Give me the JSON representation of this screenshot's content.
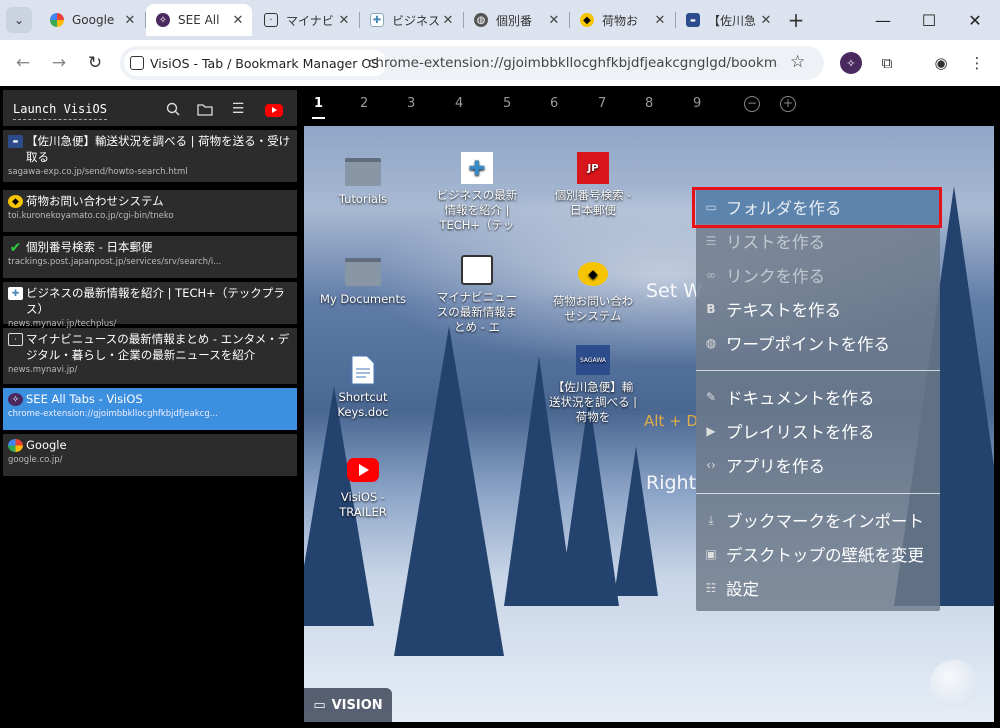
{
  "browser": {
    "tabs": [
      {
        "title": "Google",
        "icon": "google-icon",
        "active": false
      },
      {
        "title": "SEE All",
        "icon": "visios-icon",
        "active": true
      },
      {
        "title": "マイナビ",
        "icon": "monitor-icon",
        "active": false
      },
      {
        "title": "ビジネス",
        "icon": "techplus-icon",
        "active": false
      },
      {
        "title": "個別番",
        "icon": "globe-icon",
        "active": false
      },
      {
        "title": "荷物お",
        "icon": "yamato-icon",
        "active": false
      },
      {
        "title": "【佐川急",
        "icon": "sagawa-icon",
        "active": false
      }
    ],
    "site_chip_label": "VisiOS - Tab / Bookmark Manager OS",
    "url": "chrome-extension://gjoimbbkllocghfkbjdfjeakcgnglgd/bookma..."
  },
  "sidebar": {
    "launch_label": "Launch VisiOS",
    "tab_cards": [
      {
        "title": "【佐川急便】輸送状況を調べる | 荷物を送る・受け取る",
        "url": "sagawa-exp.co.jp/send/howto-search.html",
        "icon": "sagawa-icon",
        "selected": false
      },
      {
        "title": "荷物お問い合わせシステム",
        "url": "toi.kuronekoyamato.co.jp/cgi-bin/tneko",
        "icon": "yamato-icon",
        "selected": false
      },
      {
        "title": "個別番号検索 - 日本郵便",
        "url": "trackings.post.japanpost.jp/services/srv/search/i...",
        "icon": "checkmark-icon",
        "selected": false
      },
      {
        "title": "ビジネスの最新情報を紹介 | TECH+（テックプラス）",
        "url": "news.mynavi.jp/techplus/",
        "icon": "techplus-icon",
        "selected": false
      },
      {
        "title": "マイナビニュースの最新情報まとめ - エンタメ・デジタル・暮らし・企業の最新ニュースを紹介",
        "url": "news.mynavi.jp/",
        "icon": "monitor-icon",
        "selected": false
      },
      {
        "title": "SEE All Tabs - VisiOS",
        "url": "chrome-extension://gjoimbbkllocghfkbjdfjeakcg...",
        "icon": "visios-icon",
        "selected": true
      },
      {
        "title": "Google",
        "url": "google.co.jp/",
        "icon": "google-icon",
        "selected": false
      }
    ]
  },
  "desktop": {
    "numbers": [
      "1",
      "2",
      "3",
      "4",
      "5",
      "6",
      "7",
      "8",
      "9"
    ],
    "current": "1",
    "icons": [
      {
        "label": "Tutorials",
        "kind": "folder-icon"
      },
      {
        "label": "My Documents",
        "kind": "folder-icon"
      },
      {
        "label": "Shortcut Keys.doc",
        "kind": "document-icon"
      },
      {
        "label": "VisiOS - TRAILER",
        "kind": "youtube-icon"
      },
      {
        "label": "ビジネスの最新情報を紹介 | TECH+（テッ",
        "kind": "techplus-icon"
      },
      {
        "label": "マイナビニュースの最新情報まとめ - エ",
        "kind": "monitor-icon"
      },
      {
        "label": "個別番号検索 - 日本郵便",
        "kind": "jp-post-icon"
      },
      {
        "label": "荷物お問い合わせシステム",
        "kind": "yamato-icon"
      },
      {
        "label": "【佐川急便】輸送状況を調べる | 荷物を",
        "kind": "sagawa-icon"
      }
    ],
    "ghost_texts": [
      "Set W",
      "Alt + D",
      "Right"
    ],
    "vision_label": "VISION"
  },
  "context_menu": {
    "items": [
      {
        "label": "フォルダを作る",
        "icon": "folder-outline-icon",
        "state": "highlighted"
      },
      {
        "label": "リストを作る",
        "icon": "list-icon",
        "state": "disabled"
      },
      {
        "label": "リンクを作る",
        "icon": "link-icon",
        "state": "disabled"
      },
      {
        "label": "テキストを作る",
        "icon": "bold-b-icon",
        "state": "normal"
      },
      {
        "label": "ワープポイントを作る",
        "icon": "globe-icon",
        "state": "normal"
      },
      {
        "label": "ドキュメントを作る",
        "icon": "edit-doc-icon",
        "state": "normal"
      },
      {
        "label": "プレイリストを作る",
        "icon": "play-icon",
        "state": "normal"
      },
      {
        "label": "アプリを作る",
        "icon": "code-icon",
        "state": "normal"
      },
      {
        "label": "ブックマークをインポート",
        "icon": "download-icon",
        "state": "normal"
      },
      {
        "label": "デスクトップの壁紙を変更",
        "icon": "image-icon",
        "state": "normal"
      },
      {
        "label": "設定",
        "icon": "sliders-icon",
        "state": "normal"
      }
    ]
  }
}
